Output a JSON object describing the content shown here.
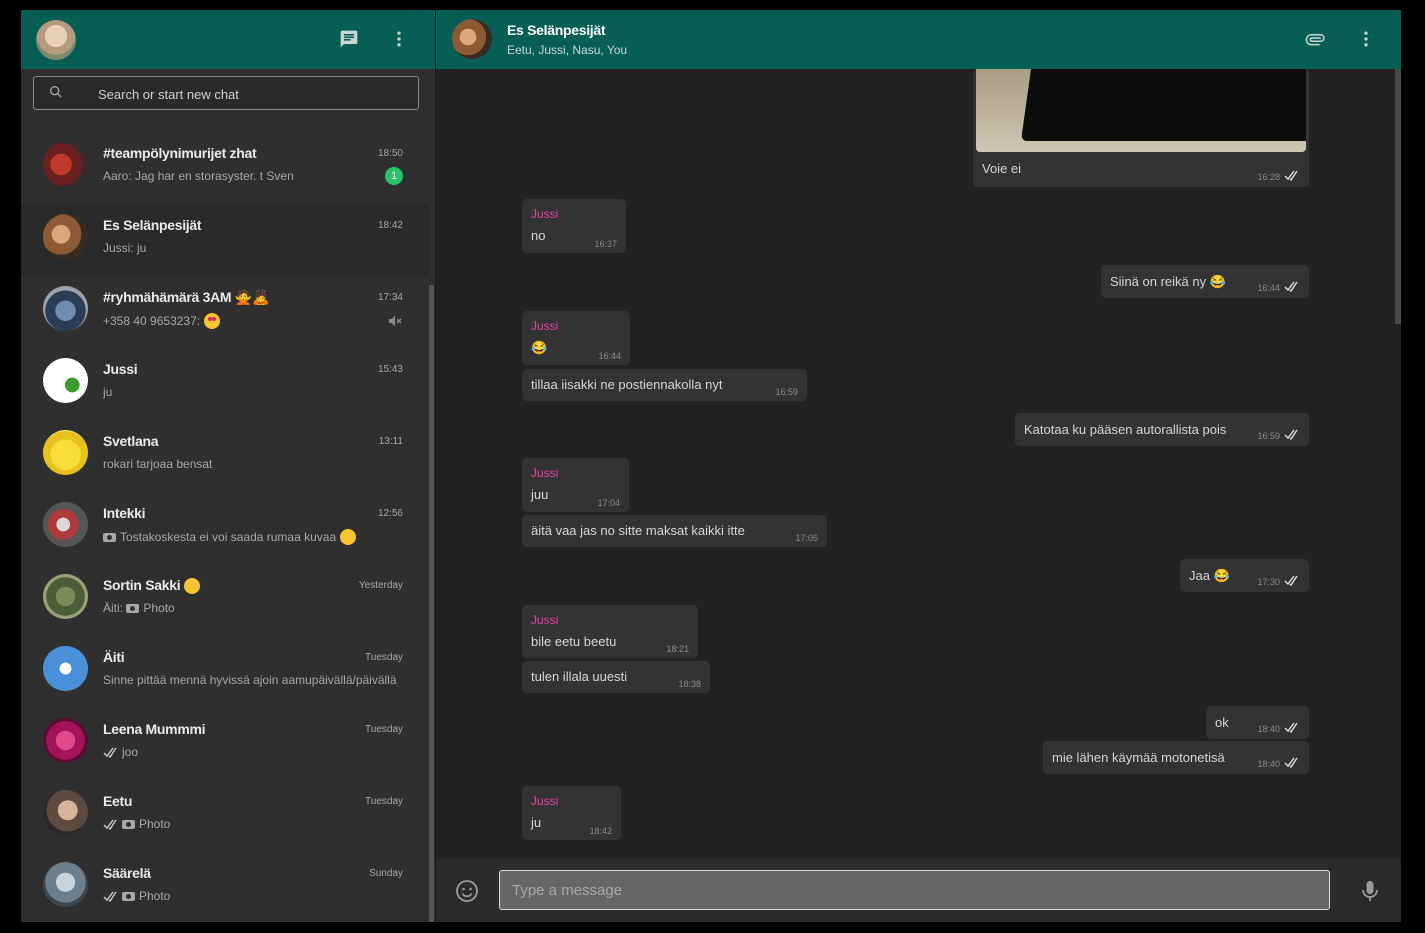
{
  "colors": {
    "header": "#075e54",
    "sender": "#e542a3",
    "badge": "#27c263"
  },
  "sidebar": {
    "header": {
      "avatar": "my-avatar",
      "new_chat_icon": "chat-icon",
      "menu_icon": "more-vert-icon"
    },
    "search": {
      "placeholder": "Search or start new chat",
      "icon": "search-icon"
    },
    "chats": [
      {
        "name": "#teampölynimurijet zhat",
        "time": "18:50",
        "preview": "Aaro: Jag har en storasyster. t Sven",
        "unread": "1"
      },
      {
        "name": "Es Selänpesijät",
        "time": "18:42",
        "preview": "Jussi: ju"
      },
      {
        "name": "#ryhmähämärä 3AM 🙅🙇",
        "time": "17:34",
        "preview": "+358 40 9653237:",
        "muted": true
      },
      {
        "name": "Jussi",
        "time": "15:43",
        "preview": "ju"
      },
      {
        "name": "Svetlana",
        "time": "13:11",
        "preview": "rokari tarjoaa bensat"
      },
      {
        "name": "Intekki",
        "time": "12:56",
        "preview": "Tostakoskesta ei voi saada rumaa kuvaa"
      },
      {
        "name": "Sortin Sakki",
        "time": "Yesterday",
        "preview_prefix": "Äiti:",
        "preview": "Photo"
      },
      {
        "name": "Äiti",
        "time": "Tuesday",
        "preview": "Sinne pittää mennä hyvissä ajoin aamupäivällä/päivällä"
      },
      {
        "name": "Leena Mummmi",
        "time": "Tuesday",
        "preview": "joo"
      },
      {
        "name": "Eetu",
        "time": "Tuesday",
        "preview": "Photo"
      },
      {
        "name": "Säärelä",
        "time": "Sunday",
        "preview": "Photo"
      }
    ]
  },
  "conversation": {
    "title": "Es Selänpesijät",
    "subtitle": "Eetu, Jussi, Nasu, You",
    "attach_icon": "paperclip-icon",
    "menu_icon": "more-vert-icon",
    "messages": [
      {
        "id": "m0",
        "out": true,
        "text": "Voie ei",
        "time": "16:28",
        "photo": true
      },
      {
        "id": "m1",
        "out": false,
        "sender": "Jussi",
        "text": "no",
        "time": "16:37"
      },
      {
        "id": "m2",
        "out": true,
        "text": "Siinä on reikä ny 😂",
        "time": "16:44"
      },
      {
        "id": "m3",
        "out": false,
        "sender": "Jussi",
        "text": "😂",
        "time": "16:44"
      },
      {
        "id": "m4",
        "out": false,
        "text": "tillaa iisakki ne postiennakolla nyt",
        "time": "16:59"
      },
      {
        "id": "m5",
        "out": true,
        "text": "Katotaa ku pääsen autorallista pois",
        "time": "16:59"
      },
      {
        "id": "m6",
        "out": false,
        "sender": "Jussi",
        "text": "juu",
        "time": "17:04"
      },
      {
        "id": "m7",
        "out": false,
        "text": "äitä vaa jas no sitte maksat kaikki itte",
        "time": "17:05"
      },
      {
        "id": "m8",
        "out": true,
        "text": "Jaa 😂",
        "time": "17:30"
      },
      {
        "id": "m9",
        "out": false,
        "sender": "Jussi",
        "text": "bile eetu beetu",
        "time": "18:21"
      },
      {
        "id": "m10",
        "out": false,
        "text": "tulen illala uuesti",
        "time": "18:38"
      },
      {
        "id": "m11",
        "out": true,
        "text": "ok",
        "time": "18:40"
      },
      {
        "id": "m12",
        "out": true,
        "text": "mie lähen käymää motonetisä",
        "time": "18:40"
      },
      {
        "id": "m13",
        "out": false,
        "sender": "Jussi",
        "text": "ju",
        "time": "18:42"
      }
    ]
  },
  "composer": {
    "placeholder": "Type a message",
    "emoji_icon": "emoji-icon",
    "mic_icon": "mic-icon"
  }
}
